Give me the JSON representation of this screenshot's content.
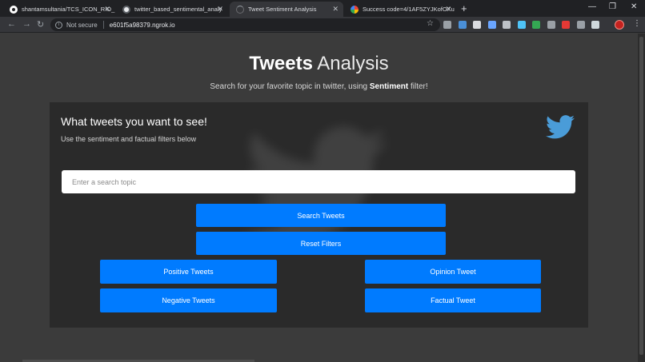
{
  "browser": {
    "tabs": [
      {
        "title": "shantamsultania/TCS_ICON_RIO_",
        "icon": "github-icon",
        "active": false
      },
      {
        "title": "twitter_based_sentimental_analy",
        "icon": "ngrok-icon",
        "active": false
      },
      {
        "title": "Tweet Sentiment Analysis",
        "icon": "loading-icon",
        "active": true
      },
      {
        "title": "Success code=4/1AF5ZYJKofOXu",
        "icon": "google-icon",
        "active": false
      }
    ],
    "close_glyph": "✕",
    "new_tab_glyph": "+",
    "window_controls": {
      "minimize": "—",
      "restore": "❐",
      "close": "✕"
    },
    "nav": {
      "back": "←",
      "forward": "→",
      "reload": "↻"
    },
    "security_label": "Not secure",
    "url": "e601f5a98379.ngrok.io",
    "star_glyph": "☆",
    "menu_glyph": "⋮",
    "extension_colors": [
      "#9aa0a6",
      "#4a90d9",
      "#dadce0",
      "#6aa5ff",
      "#bdc1c6",
      "#4fc3f7",
      "#34a853",
      "#9aa0a6",
      "#e53935",
      "#9aa0a6",
      "#cfd8dc"
    ]
  },
  "page": {
    "heading_bold": "Tweets",
    "heading_light": "Analysis",
    "subheading_prefix": "Search for your favorite topic in twitter, using ",
    "subheading_bold": "Sentiment",
    "subheading_suffix": " filter!",
    "card": {
      "title": "What tweets you want to see!",
      "subtitle": "Use the sentiment and factual filters below",
      "search_placeholder": "Enter a search topic",
      "buttons": {
        "search": "Search Tweets",
        "reset": "Reset Filters",
        "positive": "Positive Tweets",
        "negative": "Negative Tweets",
        "opinion": "Opinion Tweet",
        "factual": "Factual Tweet"
      }
    }
  },
  "colors": {
    "accent": "#007bff",
    "twitter_blue": "#4a9cd8",
    "page_bg": "#3b3b3b",
    "card_bg": "#2a2a2a"
  }
}
